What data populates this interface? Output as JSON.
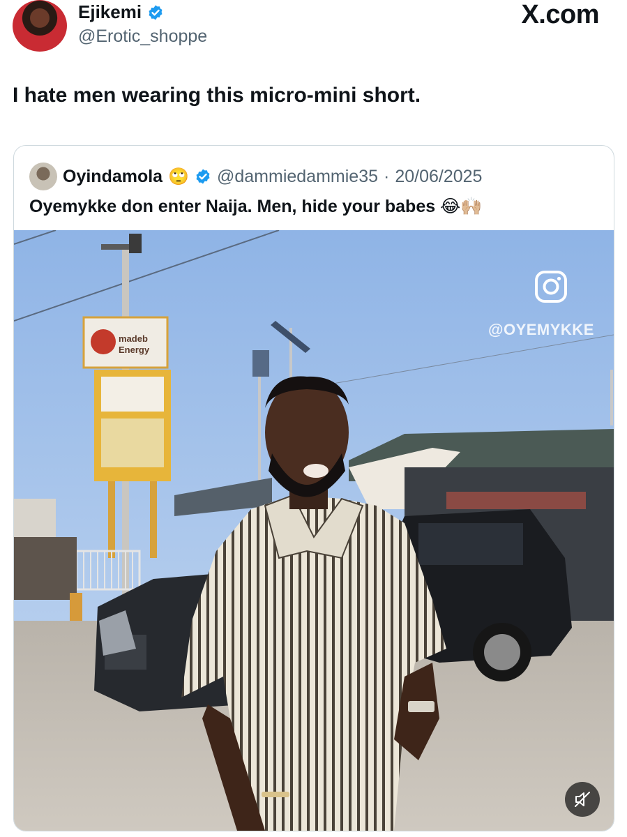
{
  "author": {
    "display_name": "Ejikemi",
    "handle": "@Erotic_shoppe",
    "verified": true,
    "avatar_icon": "profile-photo"
  },
  "brand": "X.com",
  "tweet": {
    "text": "I hate men wearing this micro-mini short."
  },
  "quoted": {
    "display_name": "Oyindamola",
    "name_emoji": "🙄",
    "verified": true,
    "handle": "@dammiedammie35",
    "separator": "·",
    "date": "20/06/2025",
    "text": "Oyemykke don enter Naija. Men, hide your babes 😂🙌🏼",
    "media": {
      "type": "video",
      "watermark": "@OYEMYKKE",
      "sign_text": "madeb Energy",
      "mute_icon": "speaker-muted-icon",
      "instagram_icon": "instagram-icon"
    }
  },
  "colors": {
    "verified_blue": "#1d9bf0",
    "muted_text": "#536471",
    "text": "#0f1419",
    "border": "#cfd9de"
  }
}
